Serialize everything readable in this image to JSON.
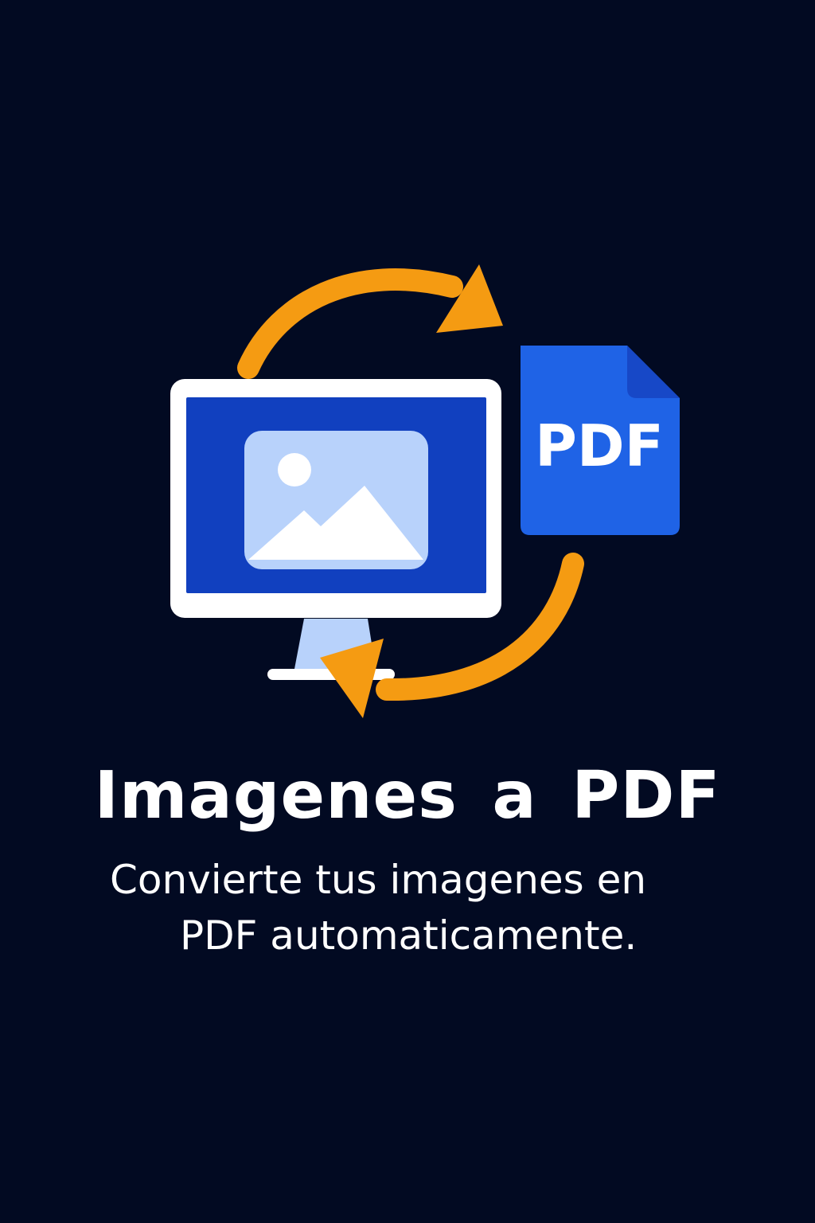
{
  "hero": {
    "title": "Imagenes a PDF",
    "subtitle_line_1": "Convierte tus imagenes en",
    "subtitle_line_2": "PDF automaticamente.",
    "pdf_badge_text": "PDF"
  },
  "icons": {
    "monitor": "monitor-icon",
    "image": "image-placeholder-icon",
    "document": "pdf-document-icon",
    "arrow_top": "curved-arrow-right-icon",
    "arrow_bottom": "curved-arrow-left-icon"
  },
  "colors": {
    "background": "#020a22",
    "monitor_frame": "#ffffff",
    "monitor_screen": "#1140bf",
    "image_card": "#b8d2fb",
    "pdf_document": "#1f63e6",
    "pdf_fold": "#1748c7",
    "arrow": "#f59b12",
    "text": "#ffffff"
  }
}
